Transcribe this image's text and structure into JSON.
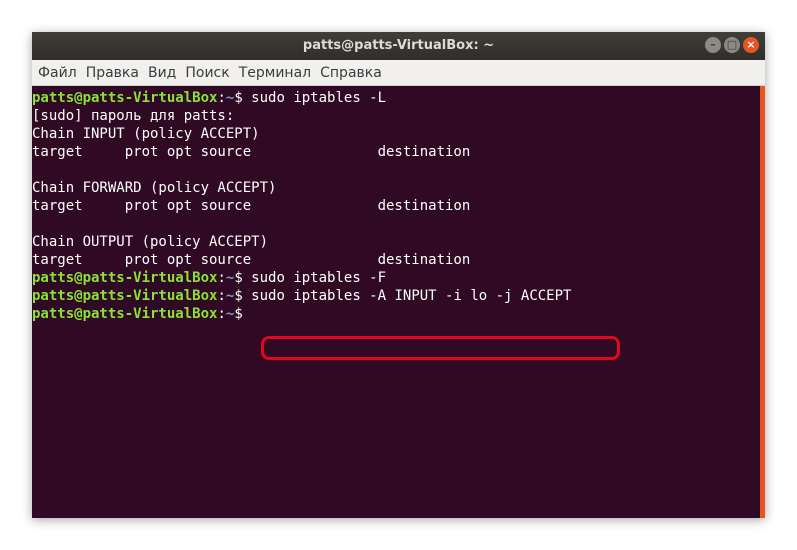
{
  "window": {
    "title": "patts@patts-VirtualBox: ~",
    "buttons": {
      "minimize": "–",
      "maximize": "□",
      "close": "×"
    }
  },
  "menu": [
    "Файл",
    "Правка",
    "Вид",
    "Поиск",
    "Терминал",
    "Справка"
  ],
  "colors": {
    "terminal_bg": "#300a24",
    "prompt_user": "#8ae234",
    "prompt_path": "#729fcf",
    "highlight": "#e4061e",
    "accent": "#e95420"
  },
  "prompt": {
    "user": "patts@patts-VirtualBox",
    "sep": ":",
    "path": "~",
    "symbol": "$ "
  },
  "lines": [
    {
      "type": "cmd",
      "text": "sudo iptables -L"
    },
    {
      "type": "out",
      "text": "[sudo] пароль для patts:"
    },
    {
      "type": "out",
      "text": "Chain INPUT (policy ACCEPT)"
    },
    {
      "type": "out",
      "text": "target     prot opt source               destination"
    },
    {
      "type": "out",
      "text": ""
    },
    {
      "type": "out",
      "text": "Chain FORWARD (policy ACCEPT)"
    },
    {
      "type": "out",
      "text": "target     prot opt source               destination"
    },
    {
      "type": "out",
      "text": ""
    },
    {
      "type": "out",
      "text": "Chain OUTPUT (policy ACCEPT)"
    },
    {
      "type": "out",
      "text": "target     prot opt source               destination"
    },
    {
      "type": "cmd",
      "text": "sudo iptables -F"
    },
    {
      "type": "cmd",
      "text": "sudo iptables -A INPUT -i lo -j ACCEPT",
      "highlighted": true
    },
    {
      "type": "cmd",
      "text": ""
    }
  ]
}
